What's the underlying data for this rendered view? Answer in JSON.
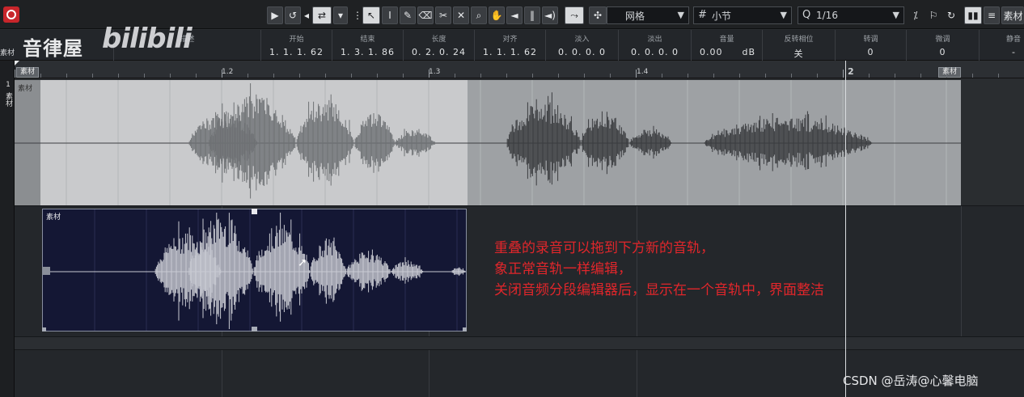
{
  "toolbar": {
    "grid_type": "网格",
    "grid_unit": "小节",
    "quantize_value": "1/16",
    "right_label": "素材",
    "quantize_label": "Q",
    "grid_icon_label": "#"
  },
  "infoline": {
    "description_header": "描述",
    "start_header": "开始",
    "start_value": "1. 1. 1. 62",
    "end_header": "结束",
    "end_value": "1. 3. 1. 86",
    "length_header": "长度",
    "length_value": "0. 2. 0. 24",
    "align_header": "对齐",
    "align_value": "1. 1. 1. 62",
    "fadein_header": "淡入",
    "fadein_value": "0. 0. 0.   0",
    "fadeout_header": "淡出",
    "fadeout_value": "0. 0. 0.   0",
    "volume_header": "音量",
    "volume_value": "0.00",
    "volume_unit": "dB",
    "reverse_header": "反转相位",
    "reverse_value": "关",
    "transpose_header": "转调",
    "transpose_value": "0",
    "finetune_header": "微调",
    "finetune_value": "0",
    "mute_header": "静音",
    "mute_value": "-"
  },
  "watermark": {
    "channel": "音律屋",
    "site": "bilibili"
  },
  "sidebar": {
    "label": "素材",
    "track_number": "1",
    "track_name": "素材"
  },
  "ruler": {
    "start_tag": "素材",
    "end_tag": "素材",
    "marks": [
      "1.2",
      "1.3",
      "1.4",
      "2"
    ]
  },
  "track1": {
    "clip_label": "素材"
  },
  "clip2": {
    "label": "素材"
  },
  "annotation": {
    "lines": [
      "重叠的录音可以拖到下方新的音轨，",
      "象正常音轨一样编辑，",
      "关闭音频分段编辑器后，显示在一个音轨中，界面整洁"
    ]
  },
  "credit": "CSDN @岳涛@心馨电脑",
  "colors": {
    "accent_red": "#e1262b",
    "clip_bg": "#141734",
    "track_bg": "#9ea1a4"
  }
}
